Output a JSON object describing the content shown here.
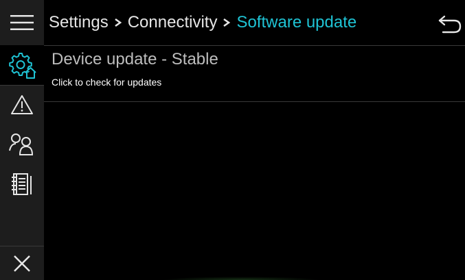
{
  "header": {
    "breadcrumbs": [
      {
        "label": "Settings"
      },
      {
        "label": "Connectivity"
      },
      {
        "label": "Software update"
      }
    ],
    "back_icon": "back-arrow-icon"
  },
  "sidebar": {
    "menu_icon": "hamburger-menu-icon",
    "items": [
      {
        "icon": "settings-home-icon",
        "active": true
      },
      {
        "icon": "warning-icon",
        "active": false
      },
      {
        "icon": "users-icon",
        "active": false
      },
      {
        "icon": "notebook-icon",
        "active": false
      }
    ],
    "close_icon": "close-icon"
  },
  "content": {
    "update_item": {
      "title": "Device update - Stable",
      "subtitle": "Click to check for updates"
    }
  },
  "colors": {
    "background": "#000000",
    "sidebar": "#1d1d1d",
    "accent": "#1fc3d4",
    "text": "#e6e6e6",
    "muted_text": "#bdbdbd",
    "divider": "#3a3a3a"
  }
}
